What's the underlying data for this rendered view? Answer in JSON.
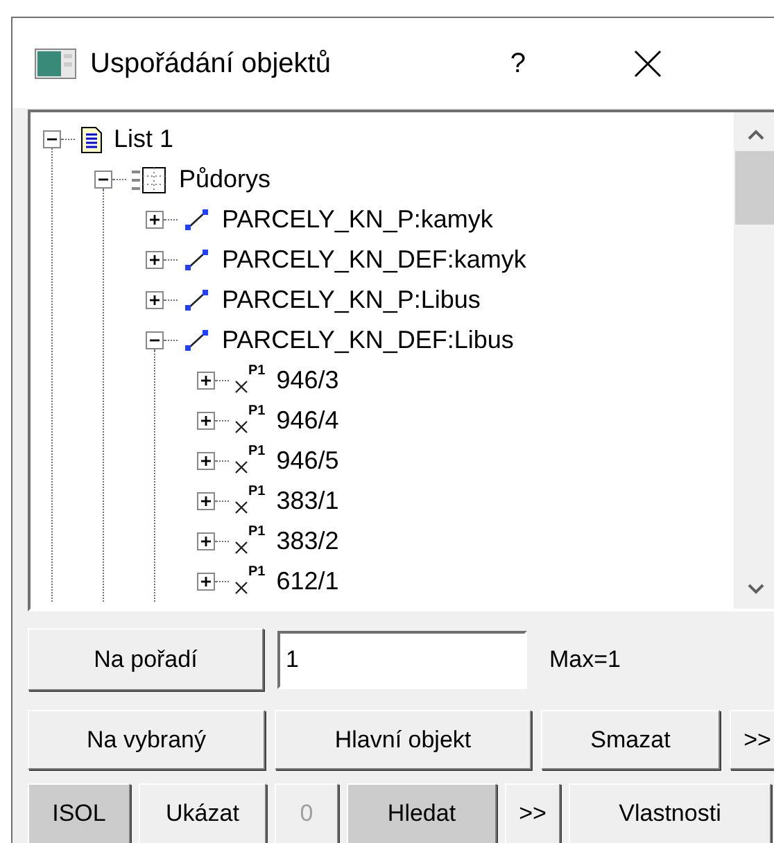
{
  "window": {
    "title": "Uspořádání objektů",
    "help": "?"
  },
  "tree": [
    {
      "label": "List 1",
      "kind": "sheet",
      "expanded": true,
      "children": [
        {
          "label": "Půdorys",
          "kind": "layout",
          "expanded": true,
          "children": [
            {
              "label": "PARCELY_KN_P:kamyk",
              "kind": "line",
              "expanded": false
            },
            {
              "label": "PARCELY_KN_DEF:kamyk",
              "kind": "line",
              "expanded": false
            },
            {
              "label": "PARCELY_KN_P:Libus",
              "kind": "line",
              "expanded": false
            },
            {
              "label": "PARCELY_KN_DEF:Libus",
              "kind": "line",
              "expanded": true,
              "children": [
                {
                  "label": "946/3",
                  "kind": "point",
                  "badge": "P1",
                  "expanded": false
                },
                {
                  "label": "946/4",
                  "kind": "point",
                  "badge": "P1",
                  "expanded": false
                },
                {
                  "label": "946/5",
                  "kind": "point",
                  "badge": "P1",
                  "expanded": false
                },
                {
                  "label": "383/1",
                  "kind": "point",
                  "badge": "P1",
                  "expanded": false
                },
                {
                  "label": "383/2",
                  "kind": "point",
                  "badge": "P1",
                  "expanded": false
                },
                {
                  "label": "612/1",
                  "kind": "point",
                  "badge": "P1",
                  "expanded": false
                }
              ]
            }
          ]
        }
      ]
    }
  ],
  "order_row": {
    "button": "Na pořadí",
    "value": "1",
    "max_label": "Max=1"
  },
  "buttons_row_1": [
    {
      "label": "Na vybraný",
      "pressed": false,
      "disabled": false
    },
    {
      "label": "Hlavní objekt",
      "pressed": false,
      "disabled": false
    },
    {
      "label": "Smazat",
      "pressed": false,
      "disabled": false
    },
    {
      "label": ">>",
      "pressed": false,
      "disabled": false
    }
  ],
  "buttons_row_2": [
    {
      "label": "ISOL",
      "pressed": true,
      "disabled": false
    },
    {
      "label": "Ukázat",
      "pressed": false,
      "disabled": false
    },
    {
      "label": "0",
      "pressed": false,
      "disabled": true
    },
    {
      "label": "Hledat",
      "pressed": true,
      "disabled": false
    },
    {
      "label": ">>",
      "pressed": false,
      "disabled": false
    },
    {
      "label": "Vlastnosti",
      "pressed": false,
      "disabled": false
    }
  ]
}
